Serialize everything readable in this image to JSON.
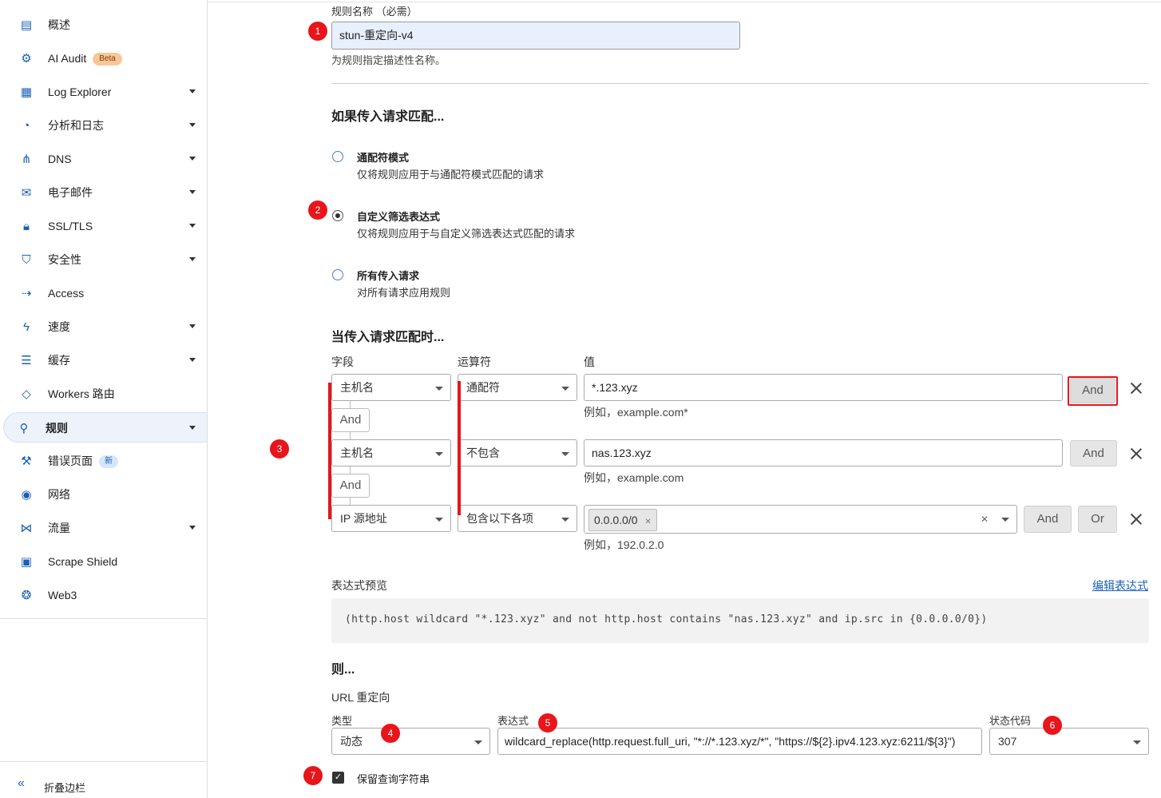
{
  "sidebar": {
    "items": [
      {
        "label": "概述",
        "icon": "document-icon",
        "caret": false
      },
      {
        "label": "AI Audit",
        "icon": "ai-audit-icon",
        "caret": false,
        "badge": "Beta"
      },
      {
        "label": "Log Explorer",
        "icon": "log-explorer-icon",
        "caret": true
      },
      {
        "label": "分析和日志",
        "icon": "pie-chart-icon",
        "caret": true
      },
      {
        "label": "DNS",
        "icon": "dns-network-icon",
        "caret": true
      },
      {
        "label": "电子邮件",
        "icon": "email-icon",
        "caret": true
      },
      {
        "label": "SSL/TLS",
        "icon": "lock-icon",
        "caret": true
      },
      {
        "label": "安全性",
        "icon": "shield-icon",
        "caret": true
      },
      {
        "label": "Access",
        "icon": "access-icon",
        "caret": false
      },
      {
        "label": "速度",
        "icon": "lightning-icon",
        "caret": true
      },
      {
        "label": "缓存",
        "icon": "cache-stack-icon",
        "caret": true
      },
      {
        "label": "Workers 路由",
        "icon": "workers-icon",
        "caret": false
      },
      {
        "label": "规则",
        "icon": "rules-funnel-icon",
        "caret": true,
        "active": true
      },
      {
        "label": "错误页面",
        "icon": "wrench-icon",
        "caret": false,
        "badge": "新"
      },
      {
        "label": "网络",
        "icon": "location-pin-icon",
        "caret": false
      },
      {
        "label": "流量",
        "icon": "traffic-icon",
        "caret": true
      },
      {
        "label": "Scrape Shield",
        "icon": "scrape-shield-icon",
        "caret": false
      },
      {
        "label": "Web3",
        "icon": "web3-icon",
        "caret": false
      }
    ],
    "collapse_label": "折叠边栏"
  },
  "rule_name": {
    "label": "规则名称 （必需）",
    "value": "stun-重定向-v4",
    "hint": "为规则指定描述性名称。"
  },
  "match_section": {
    "title": "如果传入请求匹配...",
    "options": [
      {
        "title": "通配符模式",
        "desc": "仅将规则应用于与通配符模式匹配的请求",
        "checked": false
      },
      {
        "title": "自定义筛选表达式",
        "desc": "仅将规则应用于与自定义筛选表达式匹配的请求",
        "checked": true
      },
      {
        "title": "所有传入请求",
        "desc": "对所有请求应用规则",
        "checked": false
      }
    ]
  },
  "conditions": {
    "title": "当传入请求匹配时...",
    "col_field": "字段",
    "col_operator": "运算符",
    "col_value": "值",
    "and_label": "And",
    "or_label": "Or",
    "rows": [
      {
        "field": "主机名",
        "operator": "通配符",
        "value": "*.123.xyz",
        "example": "例如，example.com*"
      },
      {
        "field": "主机名",
        "operator": "不包含",
        "value": "nas.123.xyz",
        "example": "例如，example.com"
      },
      {
        "field": "IP 源地址",
        "operator": "包含以下各项",
        "tag": "0.0.0.0/0",
        "example": "例如，192.0.2.0"
      }
    ]
  },
  "expression": {
    "label": "表达式预览",
    "edit_link": "编辑表达式",
    "preview": "(http.host wildcard \"*.123.xyz\" and not http.host contains \"nas.123.xyz\" and ip.src in {0.0.0.0/0})"
  },
  "then_section": {
    "title": "则...",
    "action_label": "URL 重定向",
    "type_label": "类型",
    "type_value": "动态",
    "expr_label": "表达式",
    "expr_value": "wildcard_replace(http.request.full_uri, \"*://*.123.xyz/*\", \"https://${2}.ipv4.123.xyz:6211/${3}\")",
    "status_label": "状态代码",
    "status_value": "307",
    "preserve_label": "保留查询字符串",
    "preserve_checked": true
  },
  "markers": [
    "1",
    "2",
    "3",
    "4",
    "5",
    "6",
    "7"
  ],
  "colors": {
    "accent": "#1a5fb4",
    "marker": "#e8151b",
    "active_bg": "#eef3fb"
  }
}
